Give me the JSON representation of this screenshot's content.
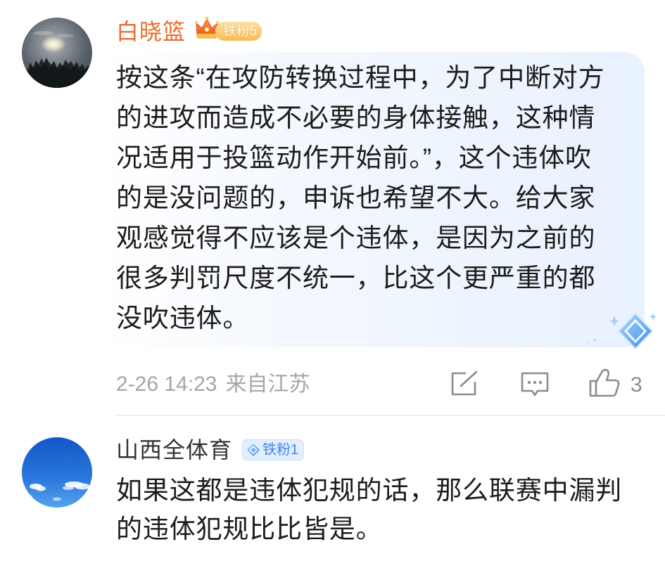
{
  "colors": {
    "vip_username": "#ee6a28",
    "plain_username": "#333333",
    "text": "#1c1c1c",
    "meta_gray": "#a6a6a6",
    "icon_gray": "#8c8c8c",
    "fan_badge_gold": "#f7bd56",
    "fan_badge_blue": "#3f87ee",
    "bubble_blue": "#e8f1fe"
  },
  "comments": [
    {
      "username": "白晓篮",
      "badge": {
        "icon": "crown-icon",
        "label": "铁粉5"
      },
      "text_lines": [
        "按这条“在攻防转换过程中，为了中断对方",
        "的进攻而造成不必要的身体接触，这种情",
        "况适用于投篮动作开始前。”，这个违体吹",
        "的是没问题的，申诉也希望不大。给大家",
        "观感觉得不应该是个违体，是因为之前的",
        "很多判罚尺度不统一，比这个更严重的都",
        "没吹违体。"
      ],
      "bubble_decoration_icon": "diamond-gem-icon",
      "timestamp": "2-26 14:23",
      "location": "来自江苏",
      "like_count": "3"
    },
    {
      "username": "山西全体育",
      "badge": {
        "icon": "diamond-icon",
        "label": "铁粉1"
      },
      "text_lines": [
        "如果这都是违体犯规的话，那么联赛中漏判",
        "的违体犯规比比皆是。"
      ]
    }
  ],
  "actions": {
    "repost_icon": "repost-icon",
    "comment_icon": "comment-icon",
    "like_icon": "thumbs-up-icon"
  }
}
